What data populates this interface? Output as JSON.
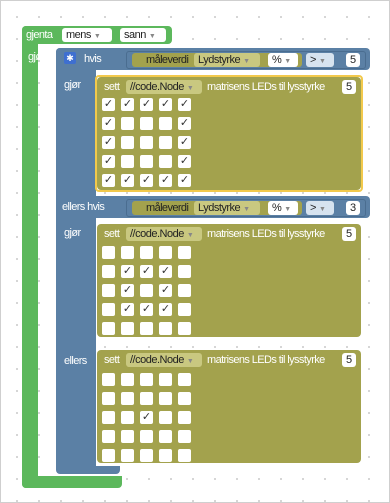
{
  "loop": {
    "label": "gjenta",
    "mode": "mens",
    "value": "sann",
    "body_label": "gjør"
  },
  "if_block": {
    "label": "hvis",
    "do_label": "gjør",
    "elseif_label": "ellers hvis",
    "else_label": "ellers"
  },
  "cond1": {
    "reading_label": "måleverdi",
    "sensor": "Lydstyrke",
    "unit": "%",
    "op": ">",
    "value": "5"
  },
  "cond2": {
    "reading_label": "måleverdi",
    "sensor": "Lydstyrke",
    "unit": "%",
    "op": ">",
    "value": "3"
  },
  "set1": {
    "set_label": "sett",
    "target": "//code.Node",
    "text": "matrisens LEDs til lysstyrke",
    "value": "5"
  },
  "set2": {
    "set_label": "sett",
    "target": "//code.Node",
    "text": "matrisens LEDs til lysstyrke",
    "value": "5"
  },
  "set3": {
    "set_label": "sett",
    "target": "//code.Node",
    "text": "matrisens LEDs til lysstyrke",
    "value": "5"
  },
  "check_mark": "✓",
  "matrix1": [
    [
      1,
      1,
      1,
      1,
      1
    ],
    [
      1,
      0,
      0,
      0,
      1
    ],
    [
      1,
      0,
      0,
      0,
      1
    ],
    [
      1,
      0,
      0,
      0,
      1
    ],
    [
      1,
      1,
      1,
      1,
      1
    ]
  ],
  "matrix2": [
    [
      0,
      0,
      0,
      0,
      0
    ],
    [
      0,
      1,
      1,
      1,
      0
    ],
    [
      0,
      1,
      0,
      1,
      0
    ],
    [
      0,
      1,
      1,
      1,
      0
    ],
    [
      0,
      0,
      0,
      0,
      0
    ]
  ],
  "matrix3": [
    [
      0,
      0,
      0,
      0,
      0
    ],
    [
      0,
      0,
      0,
      0,
      0
    ],
    [
      0,
      0,
      1,
      0,
      0
    ],
    [
      0,
      0,
      0,
      0,
      0
    ],
    [
      0,
      0,
      0,
      0,
      0
    ]
  ],
  "colors": {
    "loop": "#5cb85c",
    "logic": "#5b80a5",
    "sensor": "#a3a24d",
    "selection": "#f2c94c"
  }
}
